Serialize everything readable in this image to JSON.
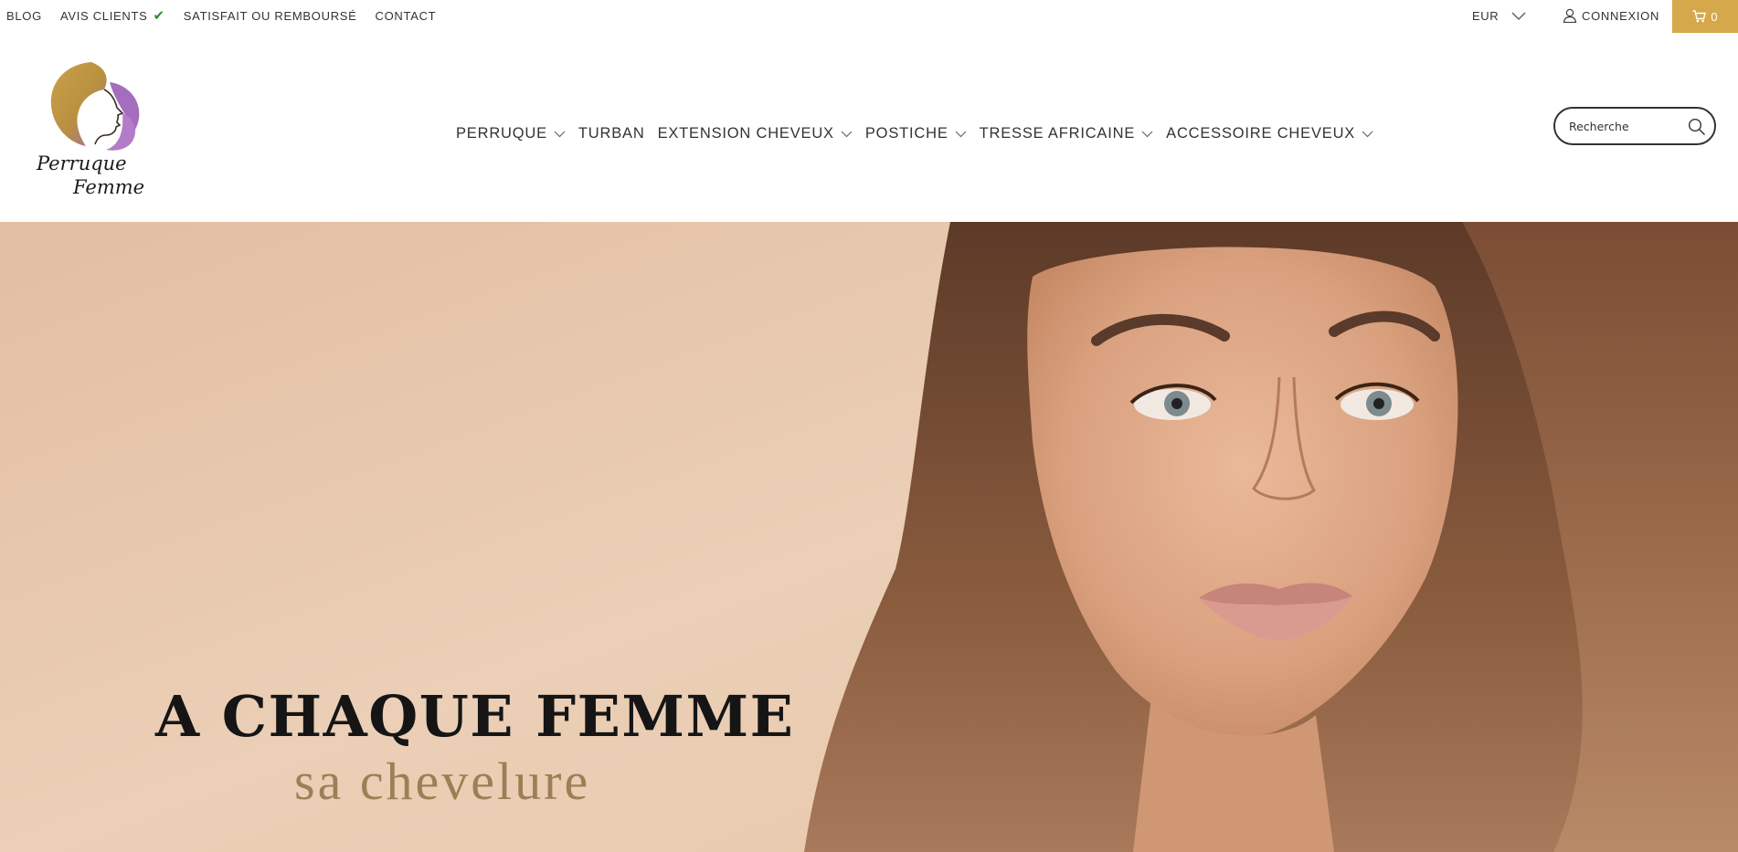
{
  "topbar": {
    "links": [
      {
        "label": "BLOG"
      },
      {
        "label": "AVIS CLIENTS"
      },
      {
        "label": "SATISFAIT OU REMBOURSÉ"
      },
      {
        "label": "CONTACT"
      }
    ],
    "currency": "EUR",
    "login_label": "CONNEXION",
    "cart_count": "0",
    "cart_color": "#d4a84b"
  },
  "header": {
    "logo": {
      "line1": "Perruque",
      "line2": "Femme"
    },
    "nav": [
      {
        "label": "PERRUQUE",
        "dropdown": true
      },
      {
        "label": "TURBAN",
        "dropdown": false
      },
      {
        "label": "EXTENSION CHEVEUX",
        "dropdown": true
      },
      {
        "label": "POSTICHE",
        "dropdown": true
      },
      {
        "label": "TRESSE AFRICAINE",
        "dropdown": true
      },
      {
        "label": "ACCESSOIRE CHEVEUX",
        "dropdown": true
      }
    ],
    "search": {
      "placeholder": "Recherche",
      "value": ""
    }
  },
  "hero": {
    "headline": "A CHAQUE FEMME",
    "subline": "sa chevelure",
    "background_color": "#e8c9ad",
    "headline_color": "#151515",
    "subline_color": "#9c7f55"
  },
  "icons": {
    "check": "check-icon",
    "chevron": "chevron-down-icon",
    "user": "user-icon",
    "cart": "cart-icon",
    "search": "search-icon"
  }
}
